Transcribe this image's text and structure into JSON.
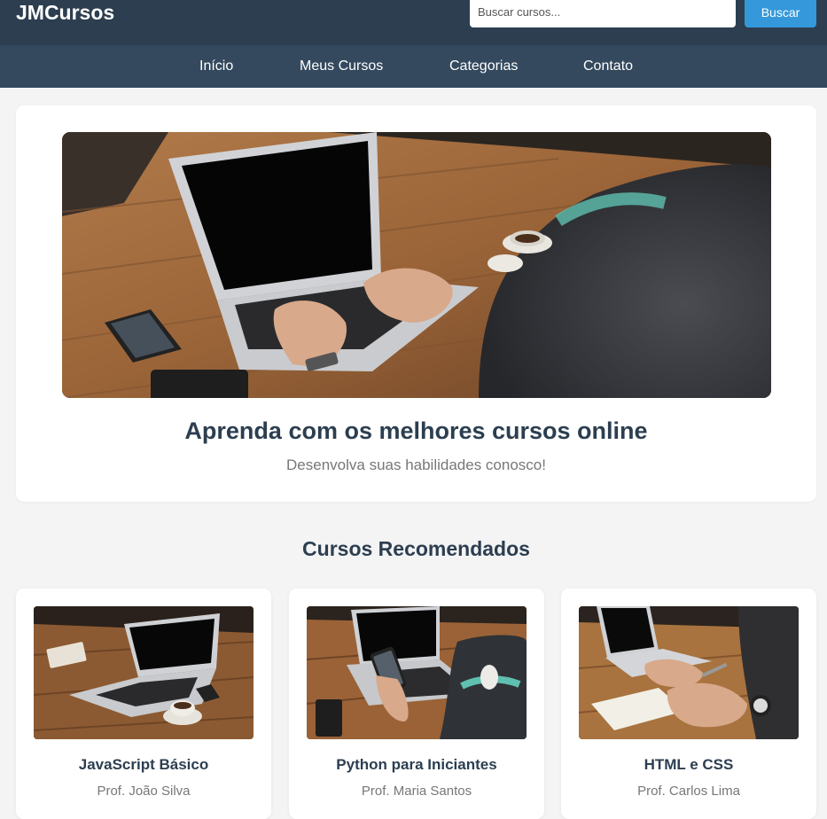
{
  "header": {
    "logo": "JMCursos",
    "search": {
      "placeholder": "Buscar cursos...",
      "value": "",
      "button_label": "Buscar"
    }
  },
  "nav": {
    "items": [
      {
        "label": "Início"
      },
      {
        "label": "Meus Cursos"
      },
      {
        "label": "Categorias"
      },
      {
        "label": "Contato"
      }
    ]
  },
  "hero": {
    "title": "Aprenda com os melhores cursos online",
    "subtitle": "Desenvolva suas habilidades conosco!"
  },
  "recommended": {
    "section_title": "Cursos Recomendados",
    "courses": [
      {
        "title": "JavaScript Básico",
        "instructor": "Prof. João Silva"
      },
      {
        "title": "Python para Iniciantes",
        "instructor": "Prof. Maria Santos"
      },
      {
        "title": "HTML e CSS",
        "instructor": "Prof. Carlos Lima"
      }
    ]
  },
  "colors": {
    "header_bg": "#2c3e50",
    "nav_bg": "#34495e",
    "accent": "#3498db",
    "page_bg": "#f4f4f4",
    "heading": "#2c3e50",
    "muted_text": "#777777"
  }
}
